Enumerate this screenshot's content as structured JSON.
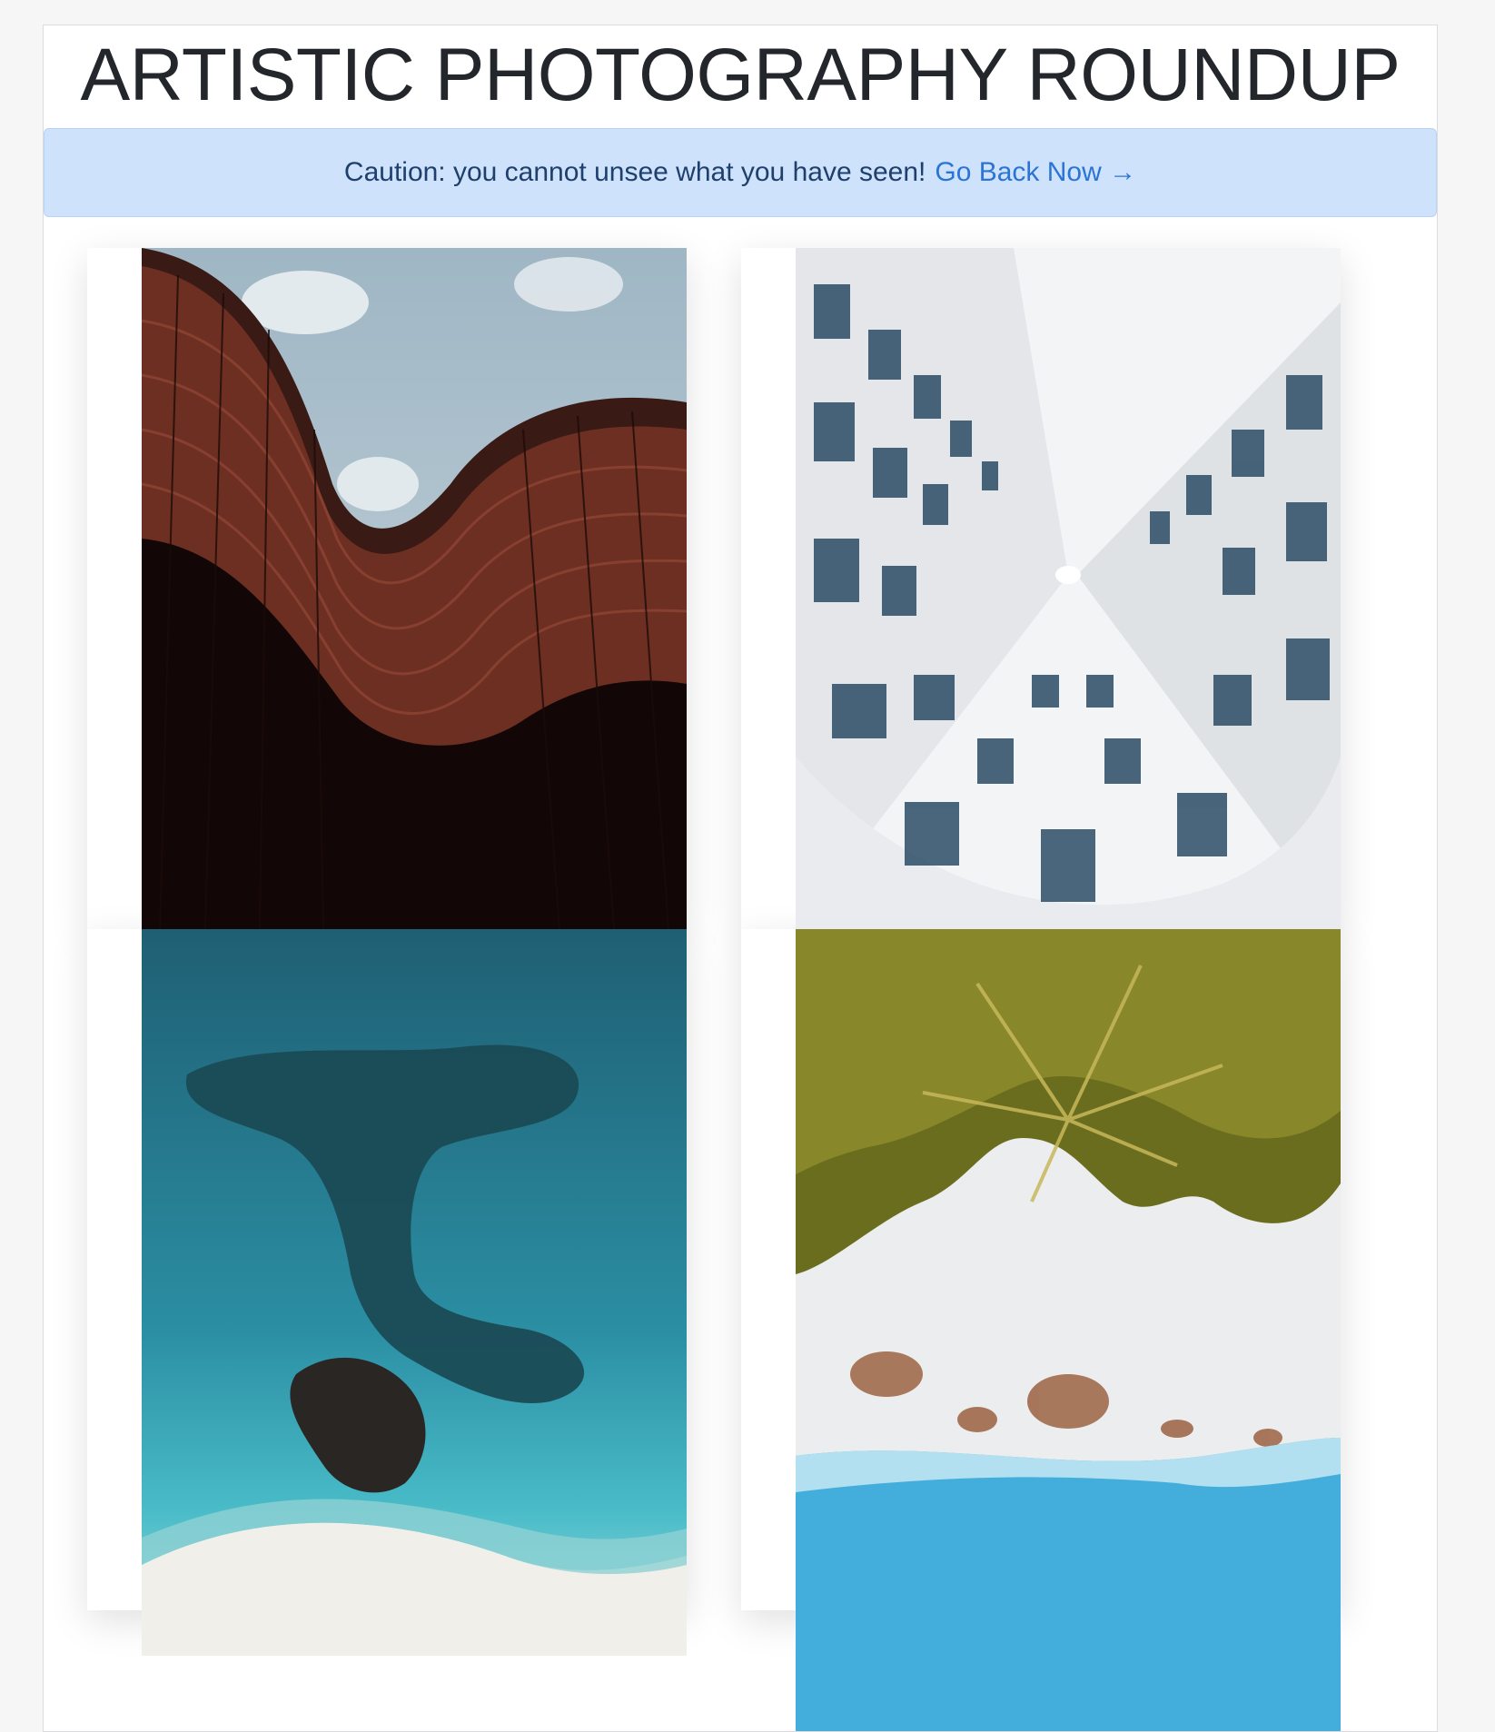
{
  "page": {
    "title": "ARTISTIC PHOTOGRAPHY ROUNDUP"
  },
  "alert": {
    "message": "Caution: you cannot unsee what you have seen!",
    "link_label": "Go Back Now →"
  },
  "gallery": {
    "photos": [
      {
        "subject": "curved-brown-building-facade"
      },
      {
        "subject": "white-building-upward-view"
      },
      {
        "subject": "aerial-coastline-rocks"
      },
      {
        "subject": "aerial-palm-trees-beach"
      }
    ]
  }
}
